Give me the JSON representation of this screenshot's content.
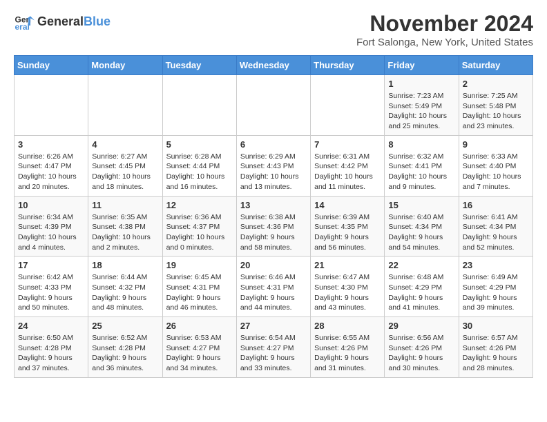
{
  "header": {
    "logo_general": "General",
    "logo_blue": "Blue",
    "month_title": "November 2024",
    "location": "Fort Salonga, New York, United States"
  },
  "weekdays": [
    "Sunday",
    "Monday",
    "Tuesday",
    "Wednesday",
    "Thursday",
    "Friday",
    "Saturday"
  ],
  "weeks": [
    [
      {
        "day": "",
        "info": ""
      },
      {
        "day": "",
        "info": ""
      },
      {
        "day": "",
        "info": ""
      },
      {
        "day": "",
        "info": ""
      },
      {
        "day": "",
        "info": ""
      },
      {
        "day": "1",
        "info": "Sunrise: 7:23 AM\nSunset: 5:49 PM\nDaylight: 10 hours and 25 minutes."
      },
      {
        "day": "2",
        "info": "Sunrise: 7:25 AM\nSunset: 5:48 PM\nDaylight: 10 hours and 23 minutes."
      }
    ],
    [
      {
        "day": "3",
        "info": "Sunrise: 6:26 AM\nSunset: 4:47 PM\nDaylight: 10 hours and 20 minutes."
      },
      {
        "day": "4",
        "info": "Sunrise: 6:27 AM\nSunset: 4:45 PM\nDaylight: 10 hours and 18 minutes."
      },
      {
        "day": "5",
        "info": "Sunrise: 6:28 AM\nSunset: 4:44 PM\nDaylight: 10 hours and 16 minutes."
      },
      {
        "day": "6",
        "info": "Sunrise: 6:29 AM\nSunset: 4:43 PM\nDaylight: 10 hours and 13 minutes."
      },
      {
        "day": "7",
        "info": "Sunrise: 6:31 AM\nSunset: 4:42 PM\nDaylight: 10 hours and 11 minutes."
      },
      {
        "day": "8",
        "info": "Sunrise: 6:32 AM\nSunset: 4:41 PM\nDaylight: 10 hours and 9 minutes."
      },
      {
        "day": "9",
        "info": "Sunrise: 6:33 AM\nSunset: 4:40 PM\nDaylight: 10 hours and 7 minutes."
      }
    ],
    [
      {
        "day": "10",
        "info": "Sunrise: 6:34 AM\nSunset: 4:39 PM\nDaylight: 10 hours and 4 minutes."
      },
      {
        "day": "11",
        "info": "Sunrise: 6:35 AM\nSunset: 4:38 PM\nDaylight: 10 hours and 2 minutes."
      },
      {
        "day": "12",
        "info": "Sunrise: 6:36 AM\nSunset: 4:37 PM\nDaylight: 10 hours and 0 minutes."
      },
      {
        "day": "13",
        "info": "Sunrise: 6:38 AM\nSunset: 4:36 PM\nDaylight: 9 hours and 58 minutes."
      },
      {
        "day": "14",
        "info": "Sunrise: 6:39 AM\nSunset: 4:35 PM\nDaylight: 9 hours and 56 minutes."
      },
      {
        "day": "15",
        "info": "Sunrise: 6:40 AM\nSunset: 4:34 PM\nDaylight: 9 hours and 54 minutes."
      },
      {
        "day": "16",
        "info": "Sunrise: 6:41 AM\nSunset: 4:34 PM\nDaylight: 9 hours and 52 minutes."
      }
    ],
    [
      {
        "day": "17",
        "info": "Sunrise: 6:42 AM\nSunset: 4:33 PM\nDaylight: 9 hours and 50 minutes."
      },
      {
        "day": "18",
        "info": "Sunrise: 6:44 AM\nSunset: 4:32 PM\nDaylight: 9 hours and 48 minutes."
      },
      {
        "day": "19",
        "info": "Sunrise: 6:45 AM\nSunset: 4:31 PM\nDaylight: 9 hours and 46 minutes."
      },
      {
        "day": "20",
        "info": "Sunrise: 6:46 AM\nSunset: 4:31 PM\nDaylight: 9 hours and 44 minutes."
      },
      {
        "day": "21",
        "info": "Sunrise: 6:47 AM\nSunset: 4:30 PM\nDaylight: 9 hours and 43 minutes."
      },
      {
        "day": "22",
        "info": "Sunrise: 6:48 AM\nSunset: 4:29 PM\nDaylight: 9 hours and 41 minutes."
      },
      {
        "day": "23",
        "info": "Sunrise: 6:49 AM\nSunset: 4:29 PM\nDaylight: 9 hours and 39 minutes."
      }
    ],
    [
      {
        "day": "24",
        "info": "Sunrise: 6:50 AM\nSunset: 4:28 PM\nDaylight: 9 hours and 37 minutes."
      },
      {
        "day": "25",
        "info": "Sunrise: 6:52 AM\nSunset: 4:28 PM\nDaylight: 9 hours and 36 minutes."
      },
      {
        "day": "26",
        "info": "Sunrise: 6:53 AM\nSunset: 4:27 PM\nDaylight: 9 hours and 34 minutes."
      },
      {
        "day": "27",
        "info": "Sunrise: 6:54 AM\nSunset: 4:27 PM\nDaylight: 9 hours and 33 minutes."
      },
      {
        "day": "28",
        "info": "Sunrise: 6:55 AM\nSunset: 4:26 PM\nDaylight: 9 hours and 31 minutes."
      },
      {
        "day": "29",
        "info": "Sunrise: 6:56 AM\nSunset: 4:26 PM\nDaylight: 9 hours and 30 minutes."
      },
      {
        "day": "30",
        "info": "Sunrise: 6:57 AM\nSunset: 4:26 PM\nDaylight: 9 hours and 28 minutes."
      }
    ]
  ]
}
